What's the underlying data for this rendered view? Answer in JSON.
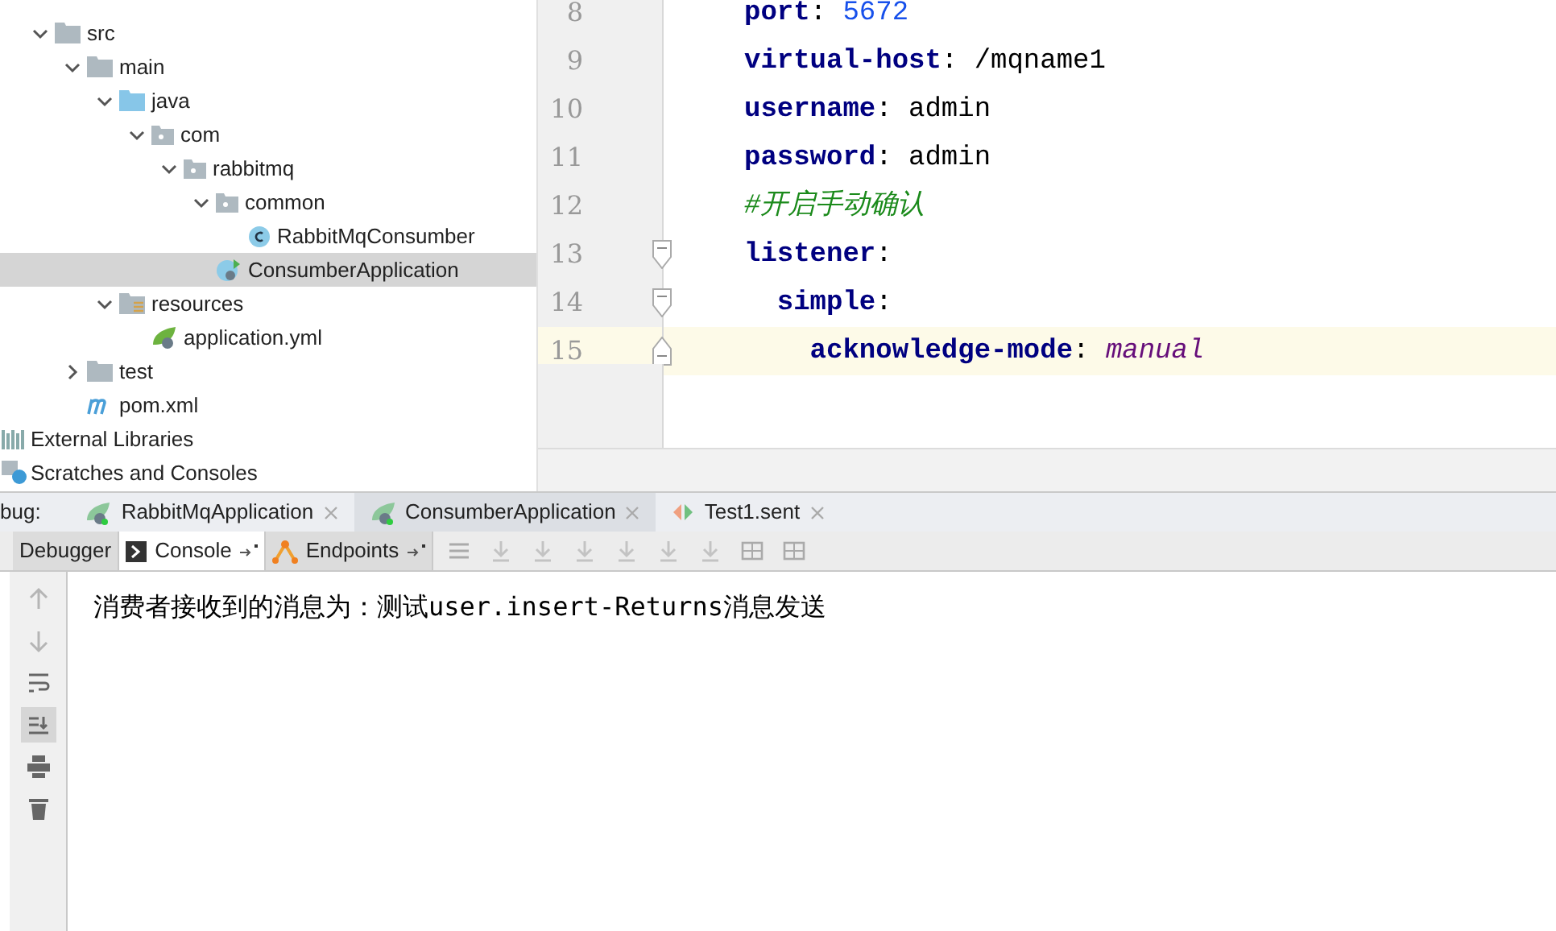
{
  "project_tree": [
    {
      "label": "src",
      "kind": "folder",
      "expanded": true,
      "selected": false,
      "children": [
        {
          "label": "main",
          "kind": "folder",
          "expanded": true,
          "selected": false,
          "children": [
            {
              "label": "java",
              "kind": "source",
              "expanded": true,
              "selected": false,
              "children": [
                {
                  "label": "com",
                  "kind": "package",
                  "expanded": true,
                  "selected": false,
                  "children": [
                    {
                      "label": "rabbitmq",
                      "kind": "package",
                      "expanded": true,
                      "selected": false,
                      "children": [
                        {
                          "label": "common",
                          "kind": "package",
                          "expanded": true,
                          "selected": false,
                          "children": [
                            {
                              "label": "RabbitMqConsumber",
                              "kind": "class",
                              "selected": false
                            }
                          ]
                        },
                        {
                          "label": "ConsumberApplication",
                          "kind": "application",
                          "selected": true
                        }
                      ]
                    }
                  ]
                }
              ]
            },
            {
              "label": "resources",
              "kind": "resources",
              "expanded": true,
              "selected": false,
              "children": [
                {
                  "label": "application.yml",
                  "kind": "yml",
                  "selected": false
                }
              ]
            }
          ]
        },
        {
          "label": "test",
          "kind": "folder",
          "expanded": false,
          "selected": false
        },
        {
          "label": "pom.xml",
          "kind": "maven",
          "selected": false
        }
      ]
    }
  ],
  "project_extras": [
    {
      "label": "External Libraries",
      "kind": "libraries"
    },
    {
      "label": "Scratches and Consoles",
      "kind": "scratches"
    }
  ],
  "editor": {
    "lines": [
      {
        "number": "8",
        "key": "port",
        "separator": ": ",
        "value": "5672",
        "kind": "number",
        "current": false
      },
      {
        "number": "9",
        "key": "virtual-host",
        "separator": ": ",
        "value": "/mqname1",
        "kind": "text",
        "current": false
      },
      {
        "number": "10",
        "key": "username",
        "separator": ": ",
        "value": "admin",
        "kind": "text",
        "current": false
      },
      {
        "number": "11",
        "key": "password",
        "separator": ": ",
        "value": "admin",
        "kind": "text",
        "current": false
      },
      {
        "number": "12",
        "value": "#开启手动确认",
        "kind": "comment",
        "current": false
      },
      {
        "number": "13",
        "key": "listener",
        "separator": ":",
        "kind": "section",
        "fold_start": true,
        "current": false
      },
      {
        "number": "14",
        "key": "  simple",
        "separator": ":",
        "kind": "section",
        "fold_start": true,
        "current": false
      },
      {
        "number": "15",
        "key": "    acknowledge-mode",
        "separator": ": ",
        "value": "manual",
        "kind": "enum",
        "fold_start": false,
        "current": true
      }
    ]
  },
  "debug": {
    "label": "bug:",
    "tabs": [
      {
        "label": "RabbitMqApplication",
        "kind": "spring",
        "selected": false
      },
      {
        "label": "ConsumberApplication",
        "kind": "spring",
        "selected": true
      },
      {
        "label": "Test1.sent",
        "kind": "http",
        "selected": false
      }
    ],
    "sub_tabs": [
      {
        "label": "Debugger",
        "kind": "plain",
        "selected": false
      },
      {
        "label": "Console",
        "kind": "console",
        "selected": true
      },
      {
        "label": "Endpoints",
        "kind": "endpoints",
        "selected": false
      }
    ],
    "console_output": "消费者接收到的消息为：测试user.insert-Returns消息发送"
  }
}
